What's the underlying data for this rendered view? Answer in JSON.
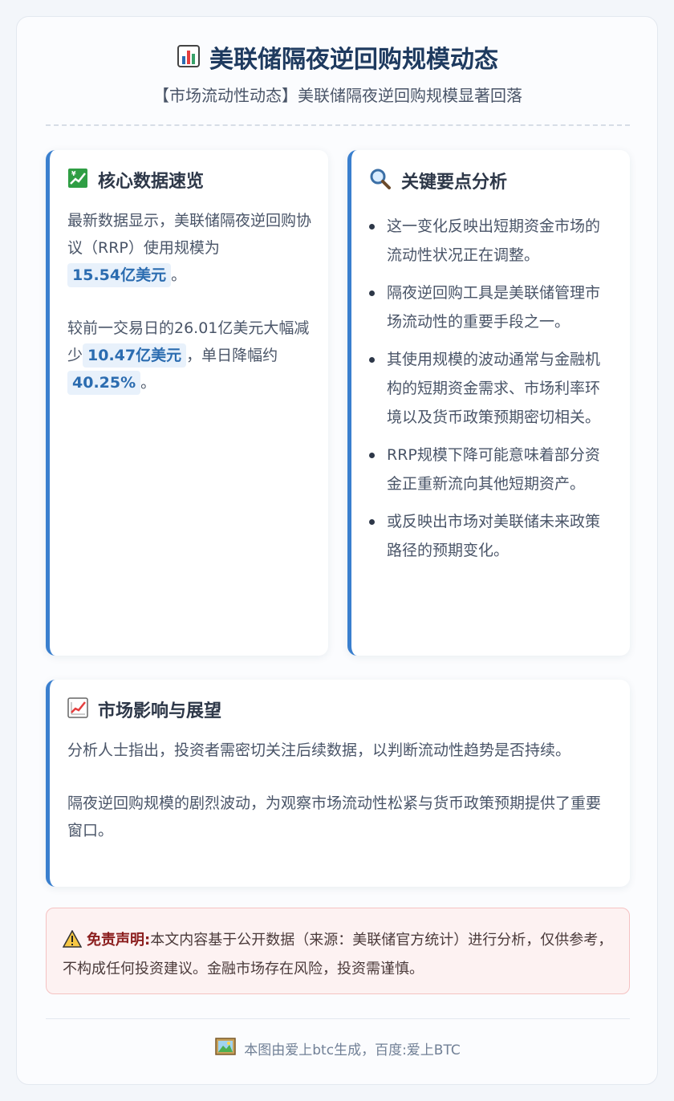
{
  "header": {
    "title": "美联储隔夜逆回购规模动态",
    "title_icon": "bar-chart-icon",
    "subtitle": "【市场流动性动态】美联储隔夜逆回购规模显著回落"
  },
  "core_data": {
    "title": "核心数据速览",
    "icon": "chart-increasing-yen-icon",
    "p1_text": "最新数据显示，美联储隔夜逆回购协议（RRP）使用规模为",
    "p1_value": "15.54亿美元",
    "p1_end": "。",
    "p2_text": "较前一交易日的26.01亿美元大幅减少",
    "p2_value1": "10.47亿美元",
    "p2_mid": "，单日降幅约",
    "p2_value2": "40.25%",
    "p2_end": "。"
  },
  "analysis": {
    "title": "关键要点分析",
    "icon": "magnifier-icon",
    "points": [
      "这一变化反映出短期资金市场的流动性状况正在调整。",
      "隔夜逆回购工具是美联储管理市场流动性的重要手段之一。",
      "其使用规模的波动通常与金融机构的短期资金需求、市场利率环境以及货币政策预期密切相关。",
      "RRP规模下降可能意味着部分资金正重新流向其他短期资产。",
      "或反映出市场对美联储未来政策路径的预期变化。"
    ]
  },
  "outlook": {
    "title": "市场影响与展望",
    "icon": "chart-increasing-icon",
    "p1": "分析人士指出，投资者需密切关注后续数据，以判断流动性趋势是否持续。",
    "p2": "隔夜逆回购规模的剧烈波动，为观察市场流动性松紧与货币政策预期提供了重要窗口。"
  },
  "disclaimer": {
    "icon": "warning-icon",
    "label": "免责声明:",
    "text": "本文内容基于公开数据（来源：美联储官方统计）进行分析，仅供参考，不构成任何投资建议。金融市场存在风险，投资需谨慎。"
  },
  "footer": {
    "icon": "framed-picture-icon",
    "text": "本图由爱上btc生成，百度:爱上BTC"
  },
  "colors": {
    "accent": "#3a7fce",
    "title": "#1e3a5f",
    "highlight_bg": "#e8f1fb",
    "highlight_text": "#2b6cb0",
    "disclaimer_bg": "#fdf2f2",
    "disclaimer_border": "#f5c2c2"
  }
}
